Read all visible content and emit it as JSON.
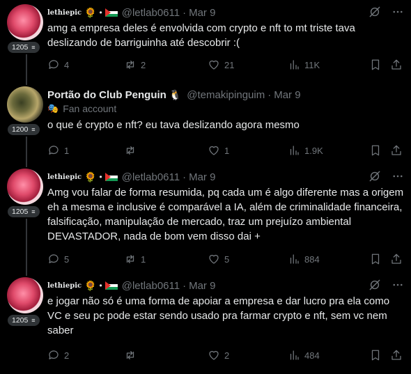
{
  "tweets": [
    {
      "display_name": "lethiepic",
      "name_emoji": "🌻",
      "handle": "@letlab0611",
      "separator": "·",
      "date": "Mar 9",
      "level": "1205",
      "text": "amg a empresa deles é envolvida com crypto e nft to mt triste tava deslizando de barriguinha até descobrir :(",
      "replies": "4",
      "reposts": "2",
      "likes": "21",
      "views": "11K"
    },
    {
      "display_name": "Portão do Club Penguin",
      "name_emoji": "🐧",
      "handle": "@temakipinguim",
      "separator": "·",
      "date": "Mar 9",
      "sub_label": "Fan account",
      "level": "1200",
      "text": "o que é crypto e nft? eu tava deslizando agora mesmo",
      "replies": "1",
      "reposts": "",
      "likes": "1",
      "views": "1.9K"
    },
    {
      "display_name": "lethiepic",
      "name_emoji": "🌻",
      "handle": "@letlab0611",
      "separator": "·",
      "date": "Mar 9",
      "level": "1205",
      "text": "Amg vou falar de forma resumida, pq cada um é algo diferente mas a origem eh a mesma e inclusive é comparável a IA, além de criminalidade financeira, falsificação, manipulação de mercado, traz um prejuízo ambiental DEVASTADOR, nada de bom vem disso dai +",
      "replies": "5",
      "reposts": "1",
      "likes": "5",
      "views": "884"
    },
    {
      "display_name": "lethiepic",
      "name_emoji": "🌻",
      "handle": "@letlab0611",
      "separator": "·",
      "date": "Mar 9",
      "level": "1205",
      "text": "e jogar não só é uma forma de apoiar a empresa e dar lucro pra ela como VC e seu pc pode estar sendo usado pra farmar crypto e nft, sem vc nem saber",
      "replies": "2",
      "reposts": "",
      "likes": "2",
      "views": "484"
    }
  ],
  "colors": {
    "background": "#000000",
    "text": "#e7e9ea",
    "muted": "#71767b",
    "thread_line": "#333639",
    "badge_bg": "#2f3336"
  },
  "icons": [
    "reply-icon",
    "repost-icon",
    "like-icon",
    "views-icon",
    "bookmark-icon",
    "share-icon",
    "grok-icon",
    "more-icon",
    "level-icon",
    "fan-mask-icon"
  ]
}
